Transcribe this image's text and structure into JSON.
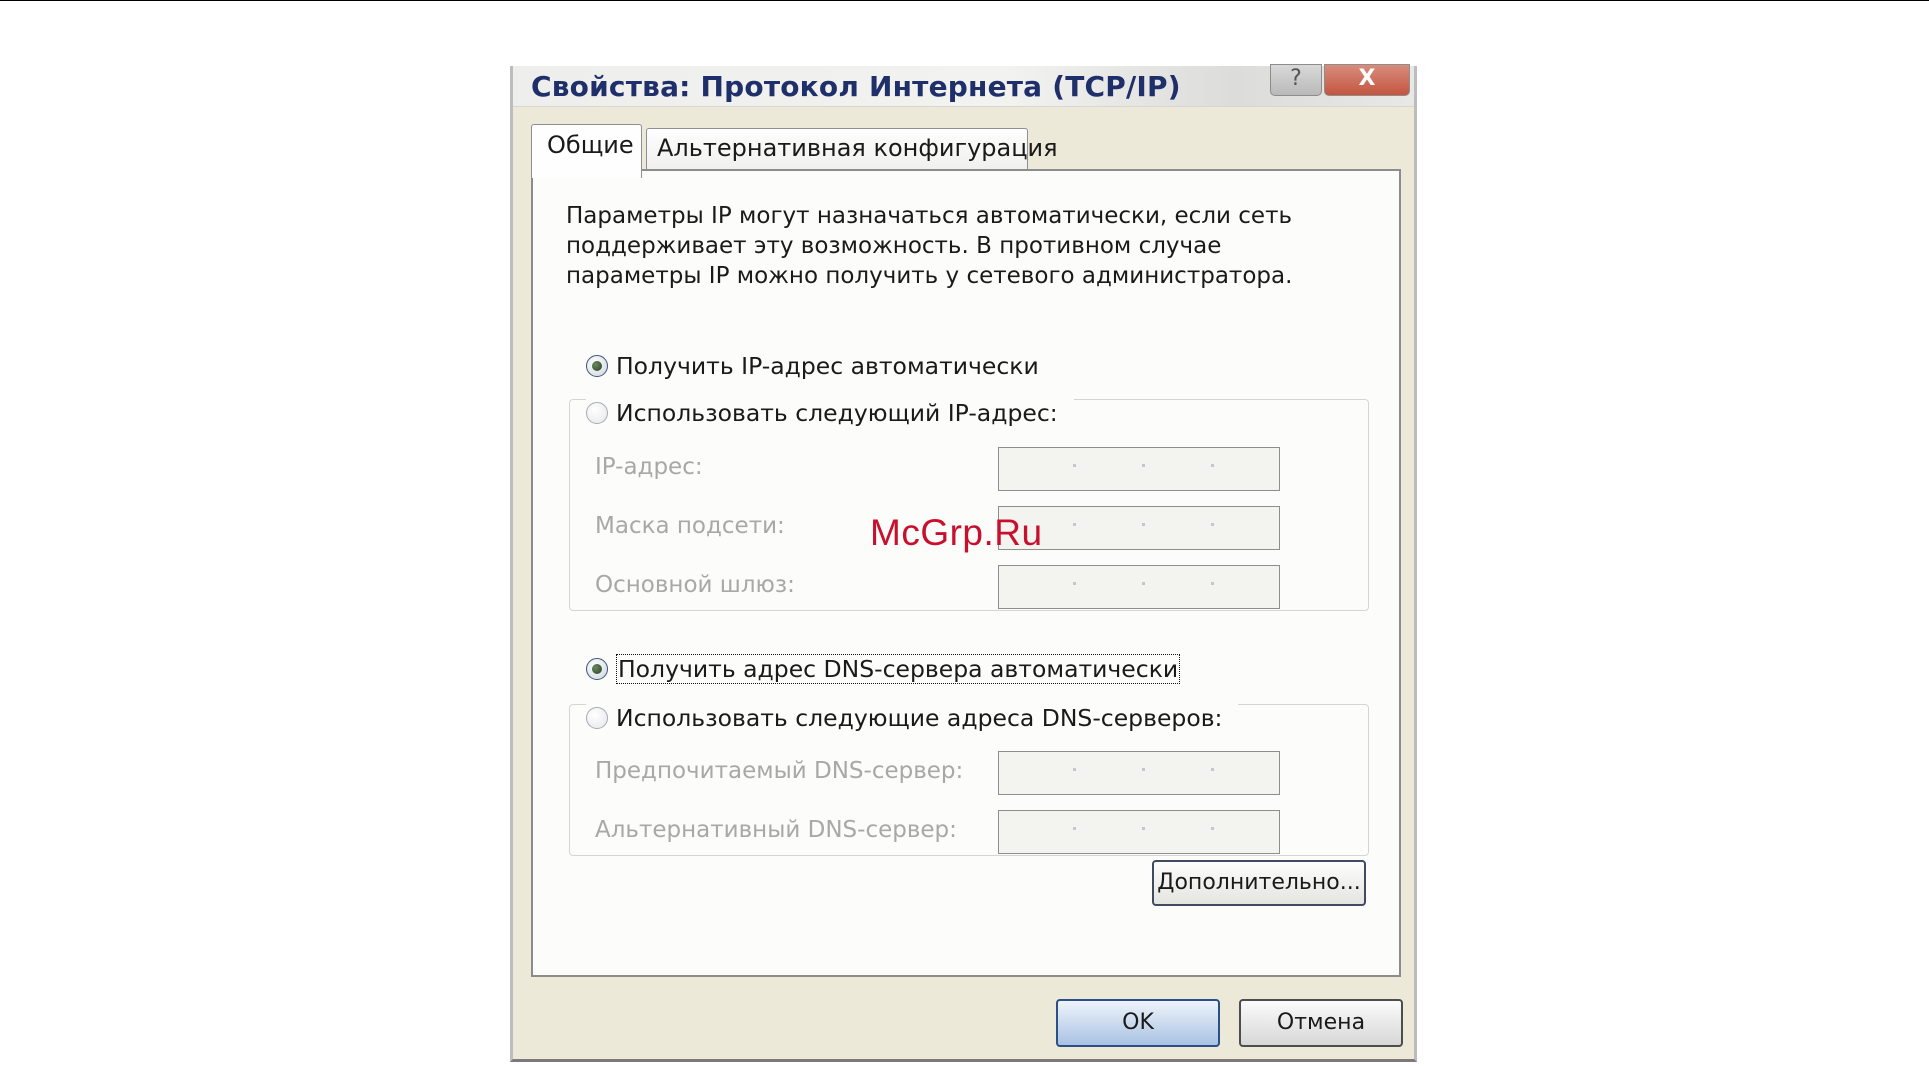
{
  "window": {
    "title": "Свойства: Протокол Интернета (TCP/IP)",
    "help_glyph": "?",
    "close_glyph": "X"
  },
  "tabs": [
    {
      "label": "Общие",
      "active": true
    },
    {
      "label": "Альтернативная конфигурация",
      "active": false
    }
  ],
  "general": {
    "description": "Параметры IP могут назначаться автоматически, если сеть поддерживает эту возможность. В противном случае параметры IP можно получить у сетевого администратора.",
    "ip_auto": {
      "label": "Получить IP-адрес автоматически",
      "checked": true
    },
    "ip_manual": {
      "label": "Использовать следующий IP-адрес:",
      "checked": false
    },
    "ip_fields": [
      {
        "label": "IP-адрес:",
        "value": ""
      },
      {
        "label": "Маска подсети:",
        "value": ""
      },
      {
        "label": "Основной шлюз:",
        "value": ""
      }
    ],
    "dns_auto": {
      "label": "Получить адрес DNS-сервера автоматически",
      "checked": true
    },
    "dns_manual": {
      "label": "Использовать следующие адреса DNS-серверов:",
      "checked": false
    },
    "dns_fields": [
      {
        "label": "Предпочитаемый DNS-сервер:",
        "value": ""
      },
      {
        "label": "Альтернативный DNS-сервер:",
        "value": ""
      }
    ],
    "advanced_label": "Дополнительно..."
  },
  "footer": {
    "ok_label": "OK",
    "cancel_label": "Отмена"
  },
  "watermark": "McGrp.Ru",
  "colors": {
    "dialog_bg": "#ece9d8",
    "title_text": "#1f2f6a",
    "close_button": "#c4553f",
    "ok_button": "#a9c2e3",
    "watermark": "#c8102e"
  }
}
